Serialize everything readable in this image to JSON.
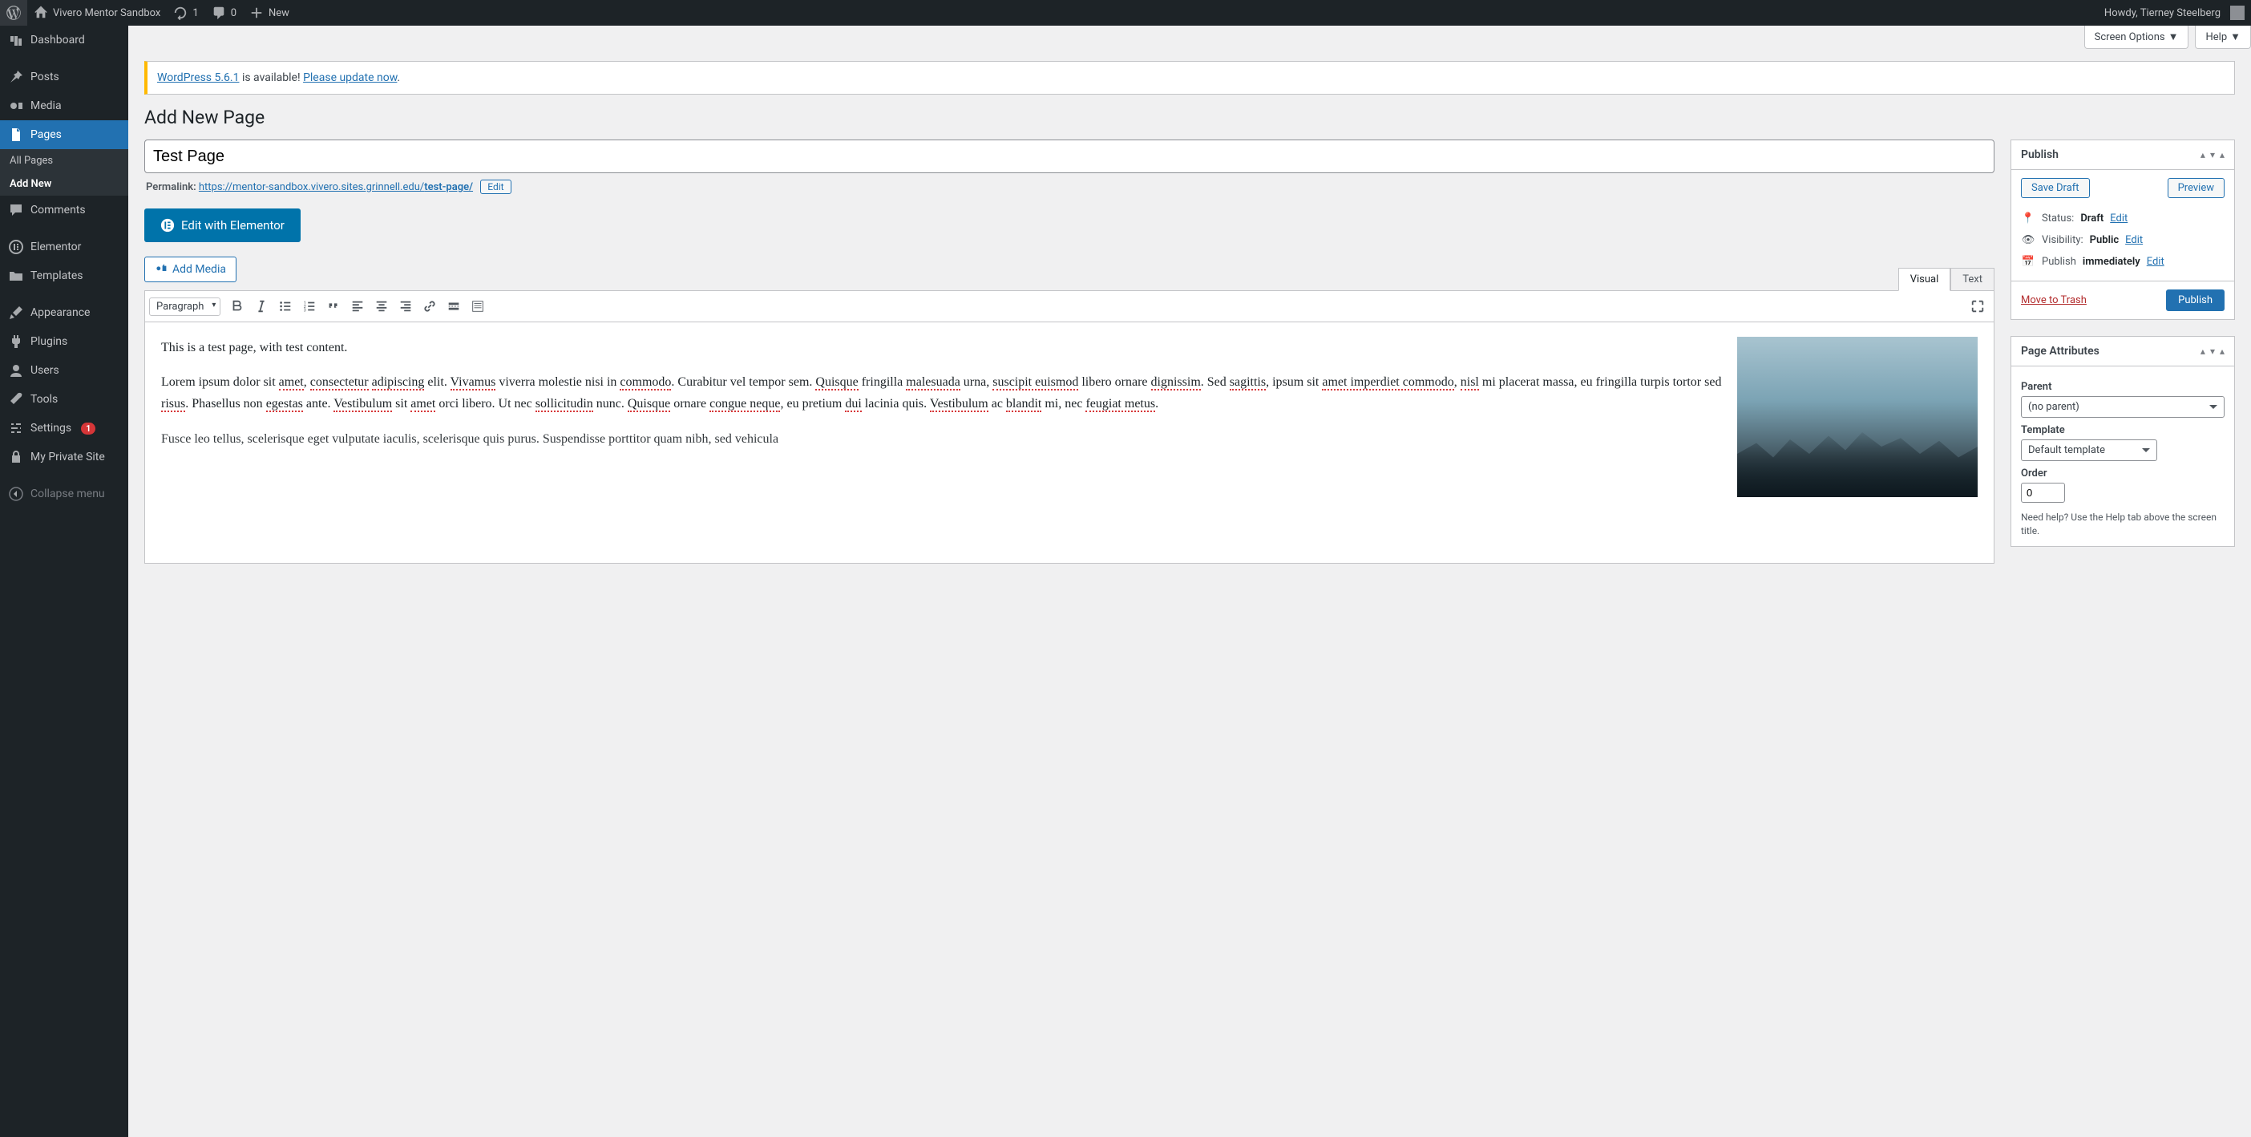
{
  "adminbar": {
    "site_name": "Vivero Mentor Sandbox",
    "refresh_count": "1",
    "comments_count": "0",
    "new_label": "New",
    "howdy": "Howdy, Tierney Steelberg"
  },
  "sidebar": {
    "items": [
      {
        "id": "dashboard",
        "label": "Dashboard"
      },
      {
        "id": "posts",
        "label": "Posts"
      },
      {
        "id": "media",
        "label": "Media"
      },
      {
        "id": "pages",
        "label": "Pages",
        "active": true
      },
      {
        "id": "comments",
        "label": "Comments"
      },
      {
        "id": "elementor",
        "label": "Elementor"
      },
      {
        "id": "templates",
        "label": "Templates"
      },
      {
        "id": "appearance",
        "label": "Appearance"
      },
      {
        "id": "plugins",
        "label": "Plugins"
      },
      {
        "id": "users",
        "label": "Users"
      },
      {
        "id": "tools",
        "label": "Tools"
      },
      {
        "id": "settings",
        "label": "Settings",
        "badge": "1"
      },
      {
        "id": "private",
        "label": "My Private Site"
      },
      {
        "id": "collapse",
        "label": "Collapse menu"
      }
    ],
    "submenu": {
      "all_pages": "All Pages",
      "add_new": "Add New"
    }
  },
  "screen_meta": {
    "screen_options": "Screen Options",
    "help": "Help"
  },
  "notice": {
    "prefix": "WordPress 5.6.1",
    "middle": " is available! ",
    "link": "Please update now",
    "suffix": "."
  },
  "page_heading": "Add New Page",
  "title_value": "Test Page",
  "permalink": {
    "label": "Permalink:",
    "url_prefix": "https://mentor-sandbox.vivero.sites.grinnell.edu/",
    "slug": "test-page/",
    "edit": "Edit"
  },
  "elementor_btn": "Edit with Elementor",
  "add_media": "Add Media",
  "editor": {
    "tab_visual": "Visual",
    "tab_text": "Text",
    "format_select": "Paragraph",
    "paragraphs": [
      "This is a test page, with test content.",
      "Lorem ipsum dolor sit amet, consectetur adipiscing elit. Vivamus viverra molestie nisi in commodo. Curabitur vel tempor sem. Quisque fringilla malesuada urna, suscipit euismod libero ornare dignissim. Sed sagittis, ipsum sit amet imperdiet commodo, nisl mi placerat massa, eu fringilla turpis tortor sed risus. Phasellus non egestas ante. Vestibulum sit amet orci libero. Ut nec sollicitudin nunc. Quisque ornare congue neque, eu pretium dui lacinia quis. Vestibulum ac blandit mi, nec feugiat metus.",
      "Fusce leo tellus, scelerisque eget vulputate iaculis, scelerisque quis purus. Suspendisse porttitor quam nibh, sed vehicula"
    ]
  },
  "publish_box": {
    "title": "Publish",
    "save_draft": "Save Draft",
    "preview": "Preview",
    "status_label": "Status:",
    "status_value": "Draft",
    "status_edit": "Edit",
    "visibility_label": "Visibility:",
    "visibility_value": "Public",
    "visibility_edit": "Edit",
    "schedule_label": "Publish",
    "schedule_value": "immediately",
    "schedule_edit": "Edit",
    "trash": "Move to Trash",
    "publish_btn": "Publish"
  },
  "attributes_box": {
    "title": "Page Attributes",
    "parent_label": "Parent",
    "parent_value": "(no parent)",
    "template_label": "Template",
    "template_value": "Default template",
    "order_label": "Order",
    "order_value": "0",
    "help": "Need help? Use the Help tab above the screen title."
  }
}
